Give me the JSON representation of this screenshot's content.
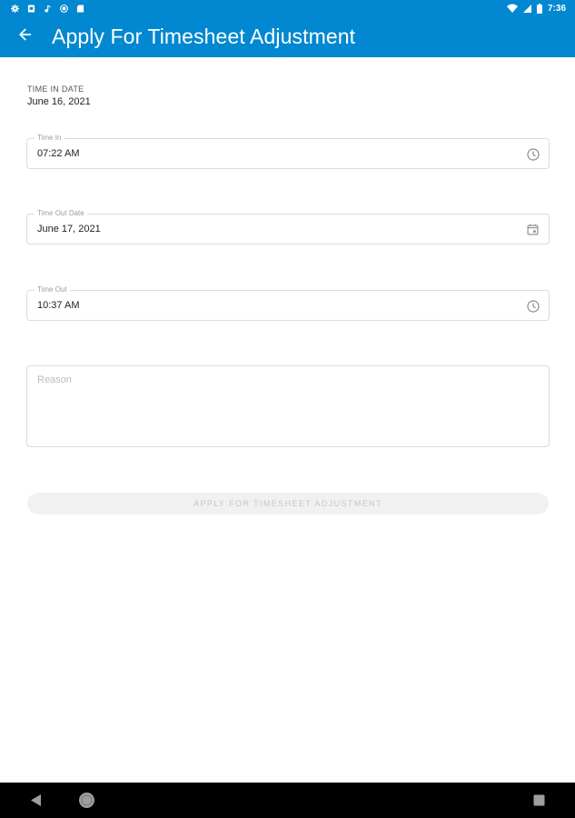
{
  "status_bar": {
    "time": "7:36",
    "left_icons": [
      "settings-icon",
      "sim-card-icon",
      "music-note-icon",
      "circle-app-icon",
      "storage-card-icon"
    ],
    "right_icons": [
      "wifi-icon",
      "cell-signal-icon",
      "battery-icon"
    ]
  },
  "app_bar": {
    "title": "Apply For Timesheet Adjustment",
    "back_icon": "arrow-left-icon",
    "background_color": "#0288d1"
  },
  "form": {
    "time_in_date": {
      "label": "TIME IN DATE",
      "value": "June 16, 2021"
    },
    "time_in": {
      "label": "Time In",
      "value": "07:22 AM",
      "icon": "clock-icon"
    },
    "time_out_date": {
      "label": "Time Out Date",
      "value": "June 17, 2021",
      "icon": "calendar-icon"
    },
    "time_out": {
      "label": "Time Out",
      "value": "10:37 AM",
      "icon": "clock-icon"
    },
    "reason": {
      "placeholder": "Reason",
      "value": ""
    },
    "submit_label": "APPLY FOR TIMESHEET ADJUSTMENT"
  },
  "nav_bar": {
    "icons": [
      "nav-back-icon",
      "nav-home-icon",
      "nav-recents-icon"
    ]
  }
}
